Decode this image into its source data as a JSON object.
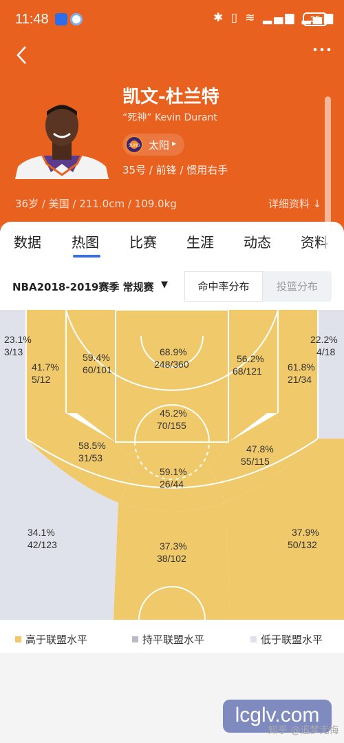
{
  "status_bar": {
    "time": "11:48",
    "icons": "✱ ▯ ≋ ▂▄▆ ▂▄▆",
    "battery": "35"
  },
  "nav": {
    "back_icon": "chevron-left-icon",
    "more_icon": "more-horizontal-icon"
  },
  "player": {
    "name": "凯文-杜兰特",
    "sub": "“死神” Kevin Durant",
    "team": "太阳",
    "team_logo_text": "SUNS",
    "info": "35号 / 前锋 / 惯用右手",
    "stats": "36岁 / 美国 / 211.0cm / 109.0kg",
    "details_link": "详细资料 ↓"
  },
  "tabs": [
    {
      "label": "数据"
    },
    {
      "label": "热图"
    },
    {
      "label": "比赛"
    },
    {
      "label": "生涯"
    },
    {
      "label": "动态"
    },
    {
      "label": "资料"
    }
  ],
  "active_tab": 1,
  "season": {
    "label": "NBA2018-2019赛季 常规赛",
    "caret": "▼"
  },
  "toggle": {
    "on": "命中率分布",
    "off": "投篮分布"
  },
  "colors": {
    "above": "#f0c96b",
    "equal": "#b9bcc4",
    "below": "#dfe2ea",
    "accent": "#e8611f",
    "tab_indicator": "#3c6fd8"
  },
  "zones": [
    {
      "pct": "23.1%",
      "made": "3/13",
      "level": "below"
    },
    {
      "pct": "41.7%",
      "made": "5/12",
      "level": "above"
    },
    {
      "pct": "59.4%",
      "made": "60/101",
      "level": "above"
    },
    {
      "pct": "68.9%",
      "made": "248/360",
      "level": "above"
    },
    {
      "pct": "56.2%",
      "made": "68/121",
      "level": "above"
    },
    {
      "pct": "61.8%",
      "made": "21/34",
      "level": "above"
    },
    {
      "pct": "22.2%",
      "made": "4/18",
      "level": "below"
    },
    {
      "pct": "45.2%",
      "made": "70/155",
      "level": "above"
    },
    {
      "pct": "58.5%",
      "made": "31/53",
      "level": "above"
    },
    {
      "pct": "47.8%",
      "made": "55/115",
      "level": "above"
    },
    {
      "pct": "59.1%",
      "made": "26/44",
      "level": "above"
    },
    {
      "pct": "34.1%",
      "made": "42/123",
      "level": "below"
    },
    {
      "pct": "37.3%",
      "made": "38/102",
      "level": "above"
    },
    {
      "pct": "37.9%",
      "made": "50/132",
      "level": "above"
    }
  ],
  "legend": [
    {
      "label": "高于联盟水平"
    },
    {
      "label": "持平联盟水平"
    },
    {
      "label": "低于联盟水平"
    }
  ],
  "watermark": {
    "zhihu": "知乎 @追梦无悔",
    "site": "lcglv.com"
  }
}
